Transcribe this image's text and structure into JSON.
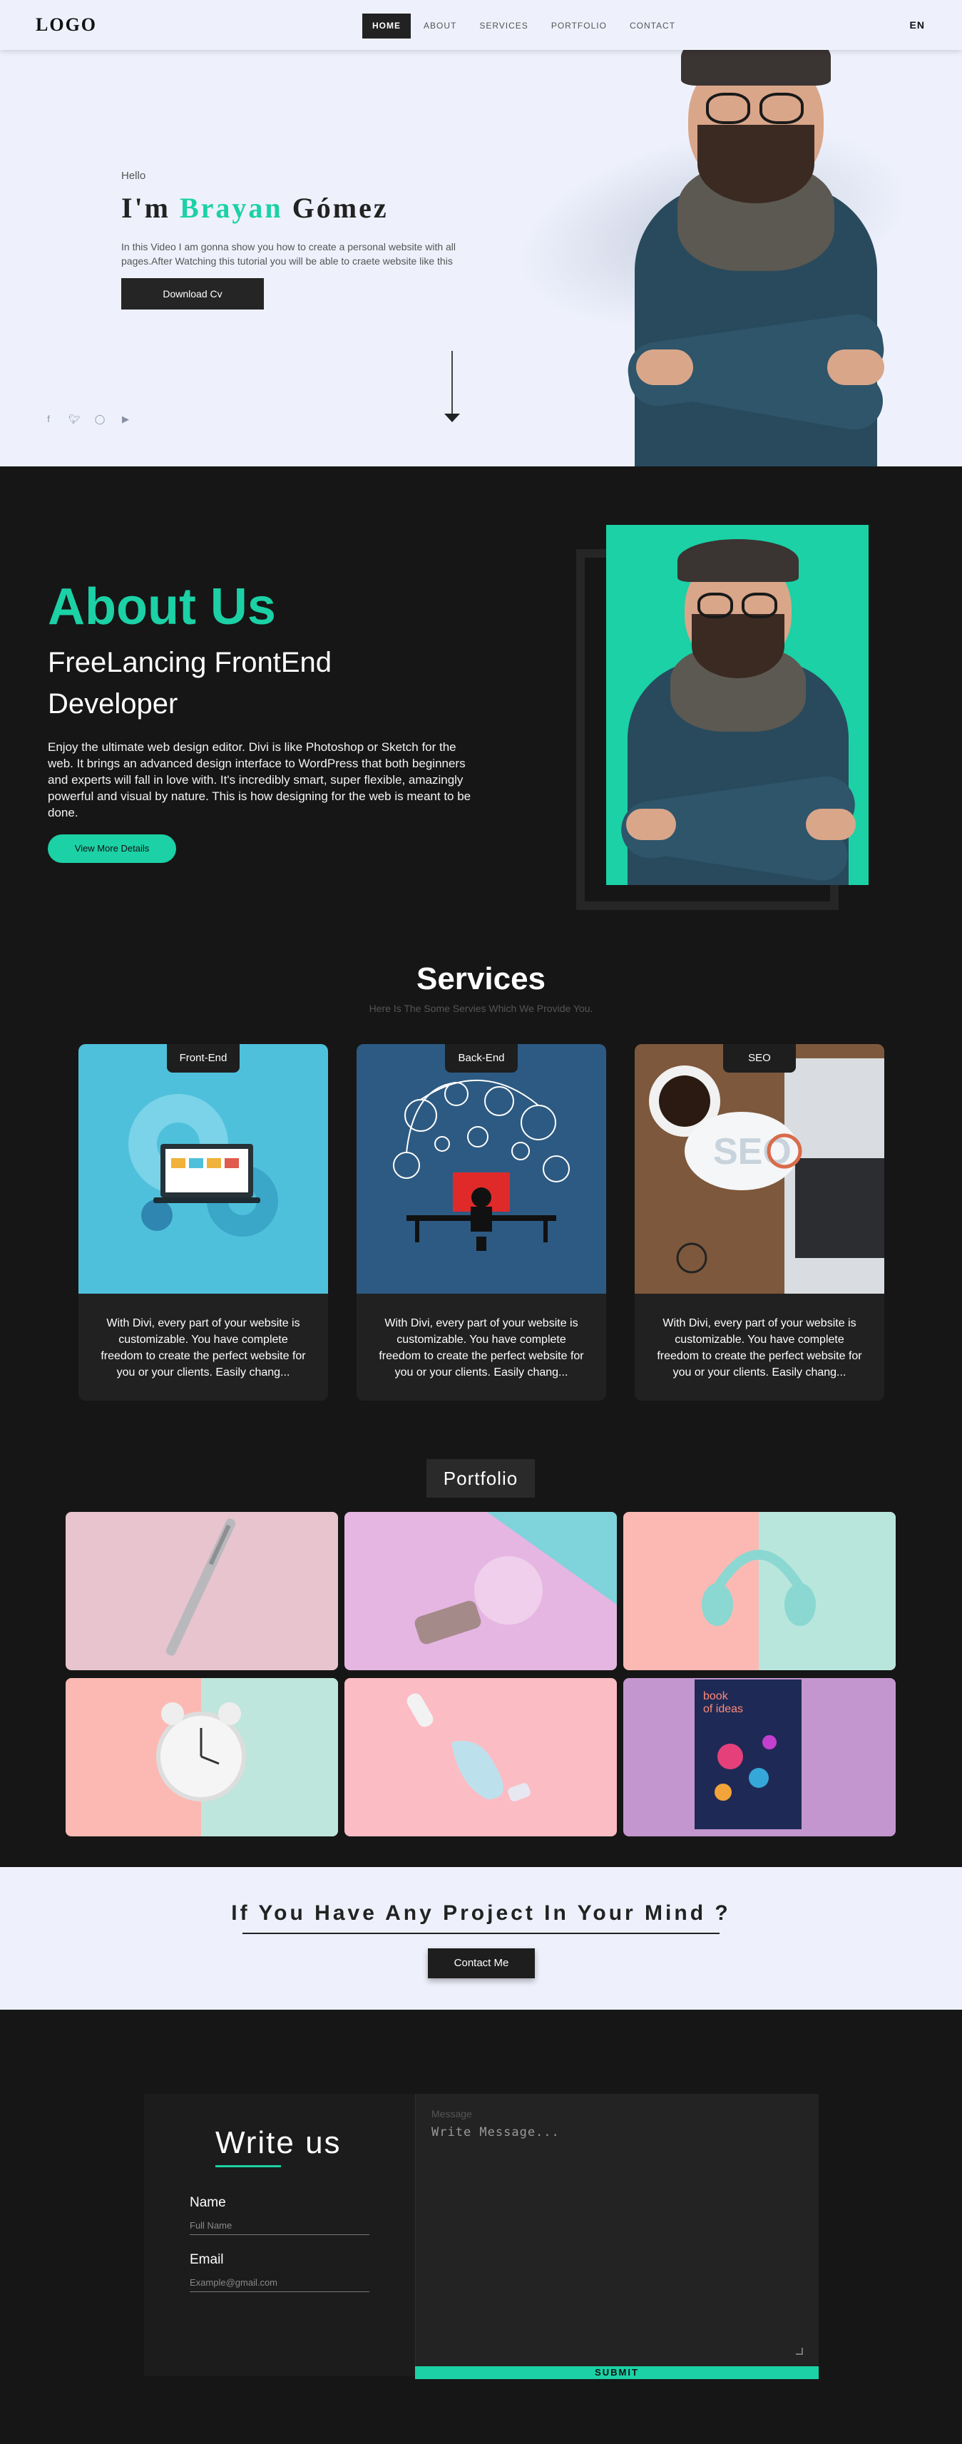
{
  "nav": {
    "logo": "LOGO",
    "items": [
      {
        "label": "HOME"
      },
      {
        "label": "ABOUT"
      },
      {
        "label": "SERVICES"
      },
      {
        "label": "PORTFOLIO"
      },
      {
        "label": "CONTACT"
      }
    ],
    "lang": "EN"
  },
  "hero": {
    "hello": "Hello",
    "title_prefix": "I'm",
    "title_accent": "Brayan",
    "title_suffix": "Gómez",
    "description": "In this Video I am gonna show you how to create a personal website with all pages.After Watching this tutorial you will be able to craete website like this",
    "button": "Download Cv",
    "social_icons": [
      "facebook-icon",
      "twitter-icon",
      "instagram-icon",
      "youtube-icon"
    ]
  },
  "about": {
    "title": "About Us",
    "subtitle": "FreeLancing FrontEnd Developer",
    "text": "Enjoy the ultimate web design editor. Divi is like Photoshop or Sketch for the web. It brings an advanced design interface to WordPress that both beginners and experts will fall in love with. It's incredibly smart, super flexible, amazingly powerful and visual by nature. This is how designing for the web is meant to be done.",
    "button": "View More Details"
  },
  "services": {
    "title": "Services",
    "subtitle": "Here Is The Some Servies Which We Provide You.",
    "cards": [
      {
        "tag": "Front-End",
        "text": "With Divi, every part of your website is customizable. You have complete freedom to create the perfect website for you or your clients. Easily chang..."
      },
      {
        "tag": "Back-End",
        "text": "With Divi, every part of your website is customizable. You have complete freedom to create the perfect website for you or your clients. Easily chang..."
      },
      {
        "tag": "SEO",
        "text": "With Divi, every part of your website is customizable. You have complete freedom to create the perfect website for you or your clients. Easily chang..."
      }
    ]
  },
  "portfolio": {
    "title": "Portfolio"
  },
  "cta": {
    "title": "If You Have Any Project In Your Mind ?",
    "button": "Contact Me"
  },
  "contact": {
    "title": "Write us",
    "name_label": "Name",
    "name_placeholder": "Full Name",
    "email_label": "Email",
    "email_placeholder": "Example@gmail.com",
    "message_label": "Message",
    "message_placeholder": "Write Message...",
    "submit": "SUBMIT"
  },
  "colors": {
    "accent": "#1bd1a5",
    "dark": "#161616",
    "light": "#eef1fc"
  }
}
